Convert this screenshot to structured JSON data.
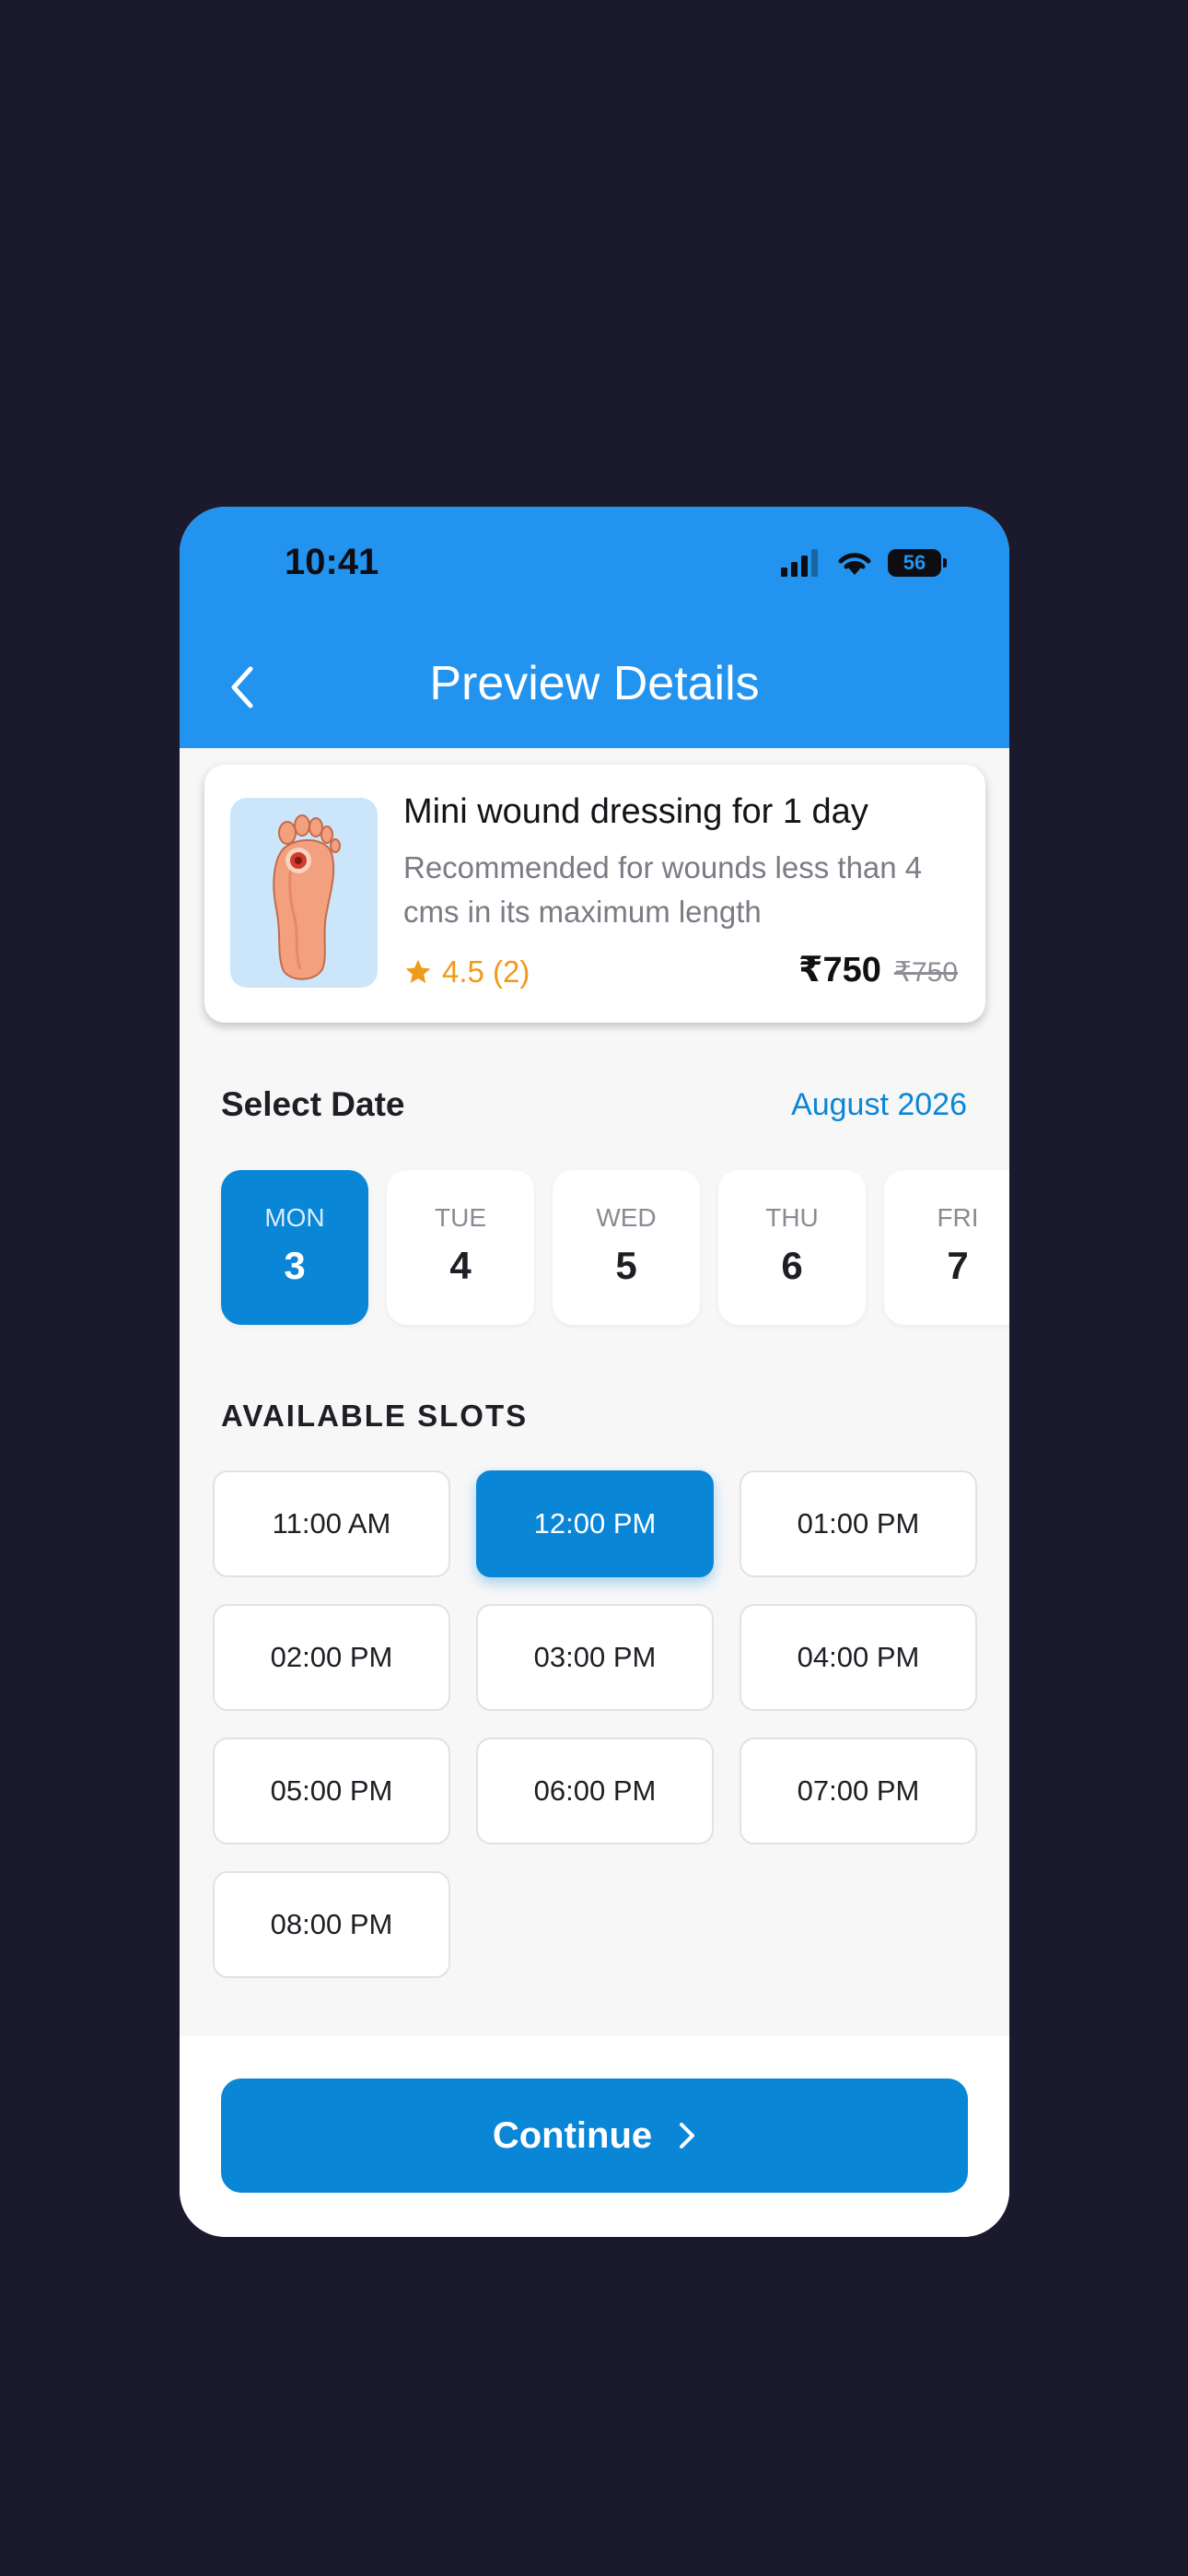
{
  "status_bar": {
    "time": "10:41",
    "battery": "56"
  },
  "header": {
    "title": "Preview Details"
  },
  "product": {
    "name": "Mini wound dressing for 1 day",
    "description": "Recommended for wounds less than 4 cms in its maximum length",
    "rating": "4.5 (2)",
    "price": "₹750",
    "original_price": "₹750"
  },
  "date_section": {
    "label": "Select Date",
    "month": "August 2026"
  },
  "days": [
    {
      "name": "MON",
      "num": "3",
      "selected": true
    },
    {
      "name": "TUE",
      "num": "4"
    },
    {
      "name": "WED",
      "num": "5"
    },
    {
      "name": "THU",
      "num": "6"
    },
    {
      "name": "FRI",
      "num": "7"
    }
  ],
  "slots_section": {
    "label": "AVAILABLE SLOTS"
  },
  "slots": [
    "11:00 AM",
    "12:00 PM",
    "01:00 PM",
    "02:00 PM",
    "03:00 PM",
    "04:00 PM",
    "05:00 PM",
    "06:00 PM",
    "07:00 PM",
    "08:00 PM"
  ],
  "selected_slot": "12:00 PM",
  "footer": {
    "continue_label": "Continue"
  },
  "colors": {
    "header": "#2294ef",
    "accent": "#0a86d6",
    "rating": "#f09a1a"
  }
}
